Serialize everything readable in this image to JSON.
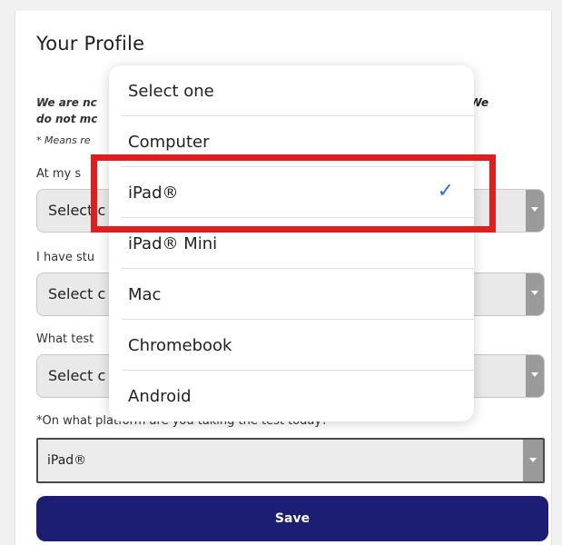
{
  "page": {
    "title": "Your Profile",
    "intro_left_line1": "We are nc",
    "intro_right": "elf. We",
    "intro_left_line2": "do not mc",
    "note": "* Means re"
  },
  "fields": [
    {
      "label": "At my s",
      "value": "Select c"
    },
    {
      "label": "I have stu",
      "value": "Select c"
    },
    {
      "label": "What test",
      "value": "Select c"
    }
  ],
  "platform": {
    "label": "*On what platform are you taking the test today?",
    "value": "iPad®"
  },
  "save_label": "Save",
  "dropdown": {
    "options": [
      "Select one",
      "Computer",
      "iPad®",
      "iPad® Mini",
      "Mac",
      "Chromebook",
      "Android"
    ],
    "selected": "iPad®",
    "check_glyph": "✓"
  },
  "colors": {
    "save_bg": "#1c1e73",
    "highlight": "#e01e1e",
    "check": "#2f6fd6"
  }
}
